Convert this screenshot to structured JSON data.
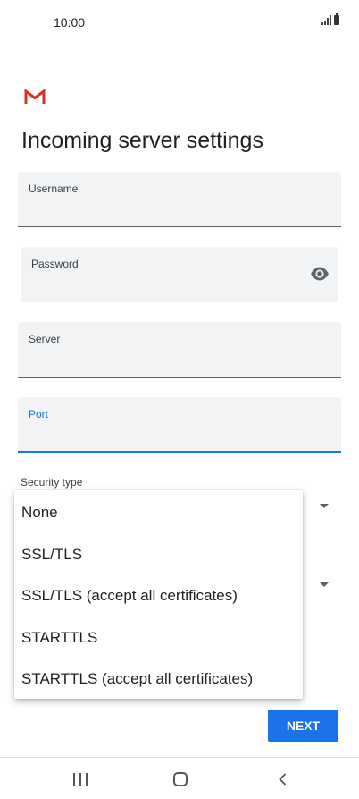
{
  "status_bar": {
    "time": "10:00"
  },
  "page": {
    "title": "Incoming server settings"
  },
  "fields": {
    "username": {
      "label": "Username",
      "value": ""
    },
    "password": {
      "label": "Password",
      "value": ""
    },
    "server": {
      "label": "Server",
      "value": ""
    },
    "port": {
      "label": "Port",
      "value": "",
      "focused": true
    }
  },
  "security": {
    "label": "Security type",
    "options": [
      "None",
      "SSL/TLS",
      "SSL/TLS (accept all certificates)",
      "STARTTLS",
      "STARTTLS (accept all certificates)"
    ]
  },
  "actions": {
    "next_label": "NEXT"
  },
  "colors": {
    "accent": "#1a73e8",
    "gmail_red": "#d93025",
    "field_bg": "#f1f3f4"
  },
  "icons": {
    "logo": "gmail-logo-icon",
    "password_toggle": "eye-icon",
    "dropdown": "arrow-drop-down-icon",
    "nav": [
      "recents-icon",
      "home-icon",
      "back-icon"
    ]
  }
}
